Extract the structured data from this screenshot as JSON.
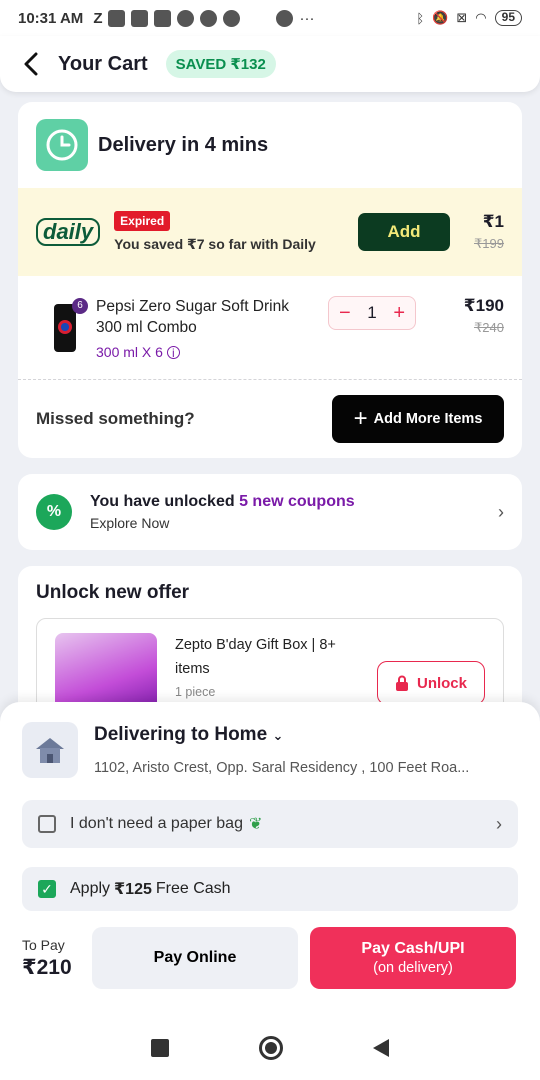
{
  "status_bar": {
    "time": "10:31 AM",
    "carrier_glyph": "Z",
    "battery": "95"
  },
  "header": {
    "title": "Your Cart",
    "saved_badge": "SAVED ₹132"
  },
  "delivery": {
    "title": "Delivery in 4 mins"
  },
  "daily": {
    "logo": "daily",
    "expired_label": "Expired",
    "saved_text": "You saved ₹7 so far with Daily",
    "add_label": "Add",
    "price": "₹1",
    "old_price": "₹199"
  },
  "item": {
    "name": "Pepsi Zero Sugar Soft Drink 300 ml Combo",
    "variant": "300 ml X 6",
    "pack_count": "6",
    "quantity": "1",
    "price": "₹190",
    "old_price": "₹240"
  },
  "missed": {
    "text": "Missed something?",
    "button_label": "Add More Items"
  },
  "coupons": {
    "title_prefix": "You have unlocked ",
    "title_accent": "5 new coupons",
    "subtitle": "Explore Now"
  },
  "offer": {
    "title": "Unlock new offer",
    "product_name": "Zepto B'day Gift Box | 8+ items",
    "product_qty": "1 piece",
    "unlock_label": "Unlock"
  },
  "address": {
    "title": "Delivering to Home",
    "text": "1102, Aristo Crest, Opp. Saral Residency , 100 Feet Roa..."
  },
  "paper_bag": {
    "label": "I don't need a paper bag"
  },
  "free_cash": {
    "prefix": "Apply",
    "amount": "₹125",
    "suffix": "Free Cash"
  },
  "payment": {
    "to_pay_label": "To Pay",
    "to_pay_value": "₹210",
    "pay_online": "Pay Online",
    "pay_cash": "Pay Cash/UPI",
    "pay_cash_sub": "(on delivery)"
  },
  "colors": {
    "accent_pink": "#f0305a",
    "brand_purple": "#7a1aa8",
    "saved_green": "#0a8f4f"
  }
}
